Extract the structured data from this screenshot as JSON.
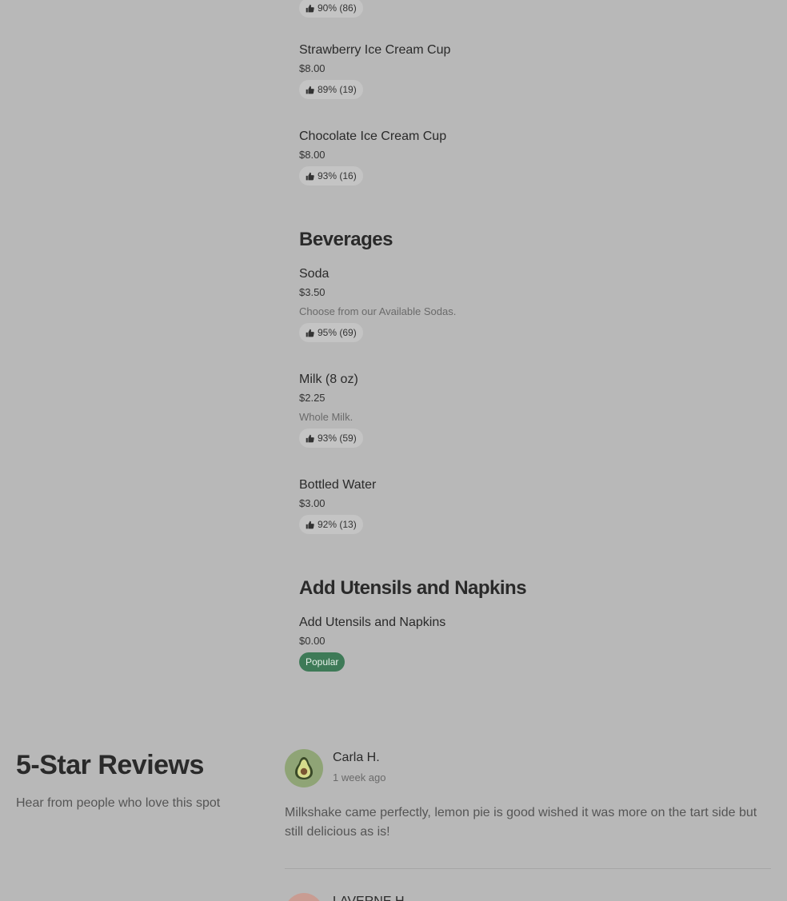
{
  "menu": {
    "top_rating": "90% (86)",
    "items": [
      {
        "name": "Strawberry Ice Cream Cup",
        "price": "$8.00",
        "rating": "89% (19)"
      },
      {
        "name": "Chocolate Ice Cream Cup",
        "price": "$8.00",
        "rating": "93% (16)"
      }
    ],
    "beverages": {
      "title": "Beverages",
      "items": [
        {
          "name": "Soda",
          "price": "$3.50",
          "description": "Choose from our Available Sodas.",
          "rating": "95% (69)"
        },
        {
          "name": "Milk (8 oz)",
          "price": "$2.25",
          "description": "Whole Milk.",
          "rating": "93% (59)"
        },
        {
          "name": "Bottled Water",
          "price": "$3.00",
          "rating": "92% (13)"
        }
      ]
    },
    "utensils": {
      "title": "Add Utensils and Napkins",
      "items": [
        {
          "name": "Add Utensils and Napkins",
          "price": "$0.00",
          "badge": "Popular"
        }
      ]
    }
  },
  "reviews": {
    "title": "5-Star Reviews",
    "subtitle": "Hear from people who love this spot",
    "list": [
      {
        "name": "Carla H.",
        "time": "1 week ago",
        "text": "Milkshake came perfectly, lemon pie is good wished it was more on the tart side but still delicious as is!",
        "avatar_icon": "avocado-icon"
      },
      {
        "name": "LAVERNE H.",
        "avatar_icon": "avatar"
      }
    ]
  },
  "colors": {
    "background": "#b8b8b8",
    "rating_pill": "#c4c4c4",
    "popular_badge": "#3e7a57",
    "avatar_green": "#8fa476"
  },
  "icons": {
    "rating": "thumbs-up-icon"
  }
}
